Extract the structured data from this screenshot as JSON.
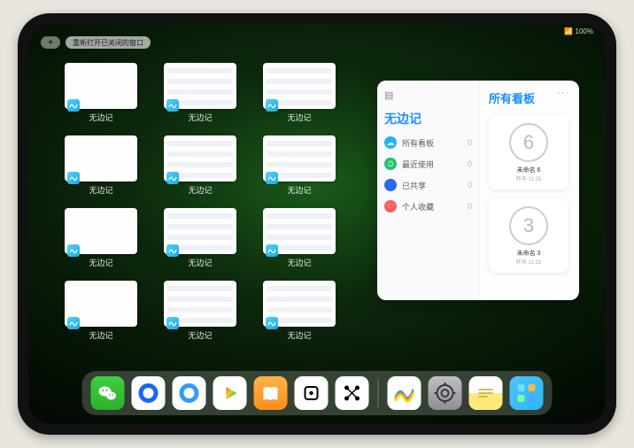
{
  "status": {
    "right": "📶 100%"
  },
  "top": {
    "plus": "+",
    "reopen_label": "重新打开已关闭的窗口"
  },
  "windows": {
    "label": "无边记",
    "rows": [
      [
        "blank",
        "content",
        "content"
      ],
      [
        "blank",
        "content",
        "content"
      ],
      [
        "blank",
        "content",
        "content"
      ],
      [
        "blank",
        "content",
        "content"
      ]
    ]
  },
  "popover": {
    "title": "无边记",
    "right_title": "所有看板",
    "ellipsis": "···",
    "menu": [
      {
        "icon": "☁",
        "color": "#1fb4ff",
        "label": "所有看板",
        "count": "0"
      },
      {
        "icon": "⏱",
        "color": "#22c16b",
        "label": "最近使用",
        "count": "0"
      },
      {
        "icon": "👤",
        "color": "#2f62ff",
        "label": "已共享",
        "count": "0"
      },
      {
        "icon": "♡",
        "color": "#ff5c5c",
        "label": "个人收藏",
        "count": "0"
      }
    ],
    "boards": [
      {
        "doodle": "6",
        "name": "未命名 6",
        "time": "昨天 11:25"
      },
      {
        "doodle": "3",
        "name": "未命名 3",
        "time": "昨天 11:25"
      }
    ]
  },
  "dock": {
    "apps_main": [
      "wechat",
      "q1",
      "q2",
      "play",
      "books",
      "dice",
      "nodes"
    ],
    "apps_recent": [
      "freeform",
      "settings",
      "notes",
      "apps"
    ]
  }
}
